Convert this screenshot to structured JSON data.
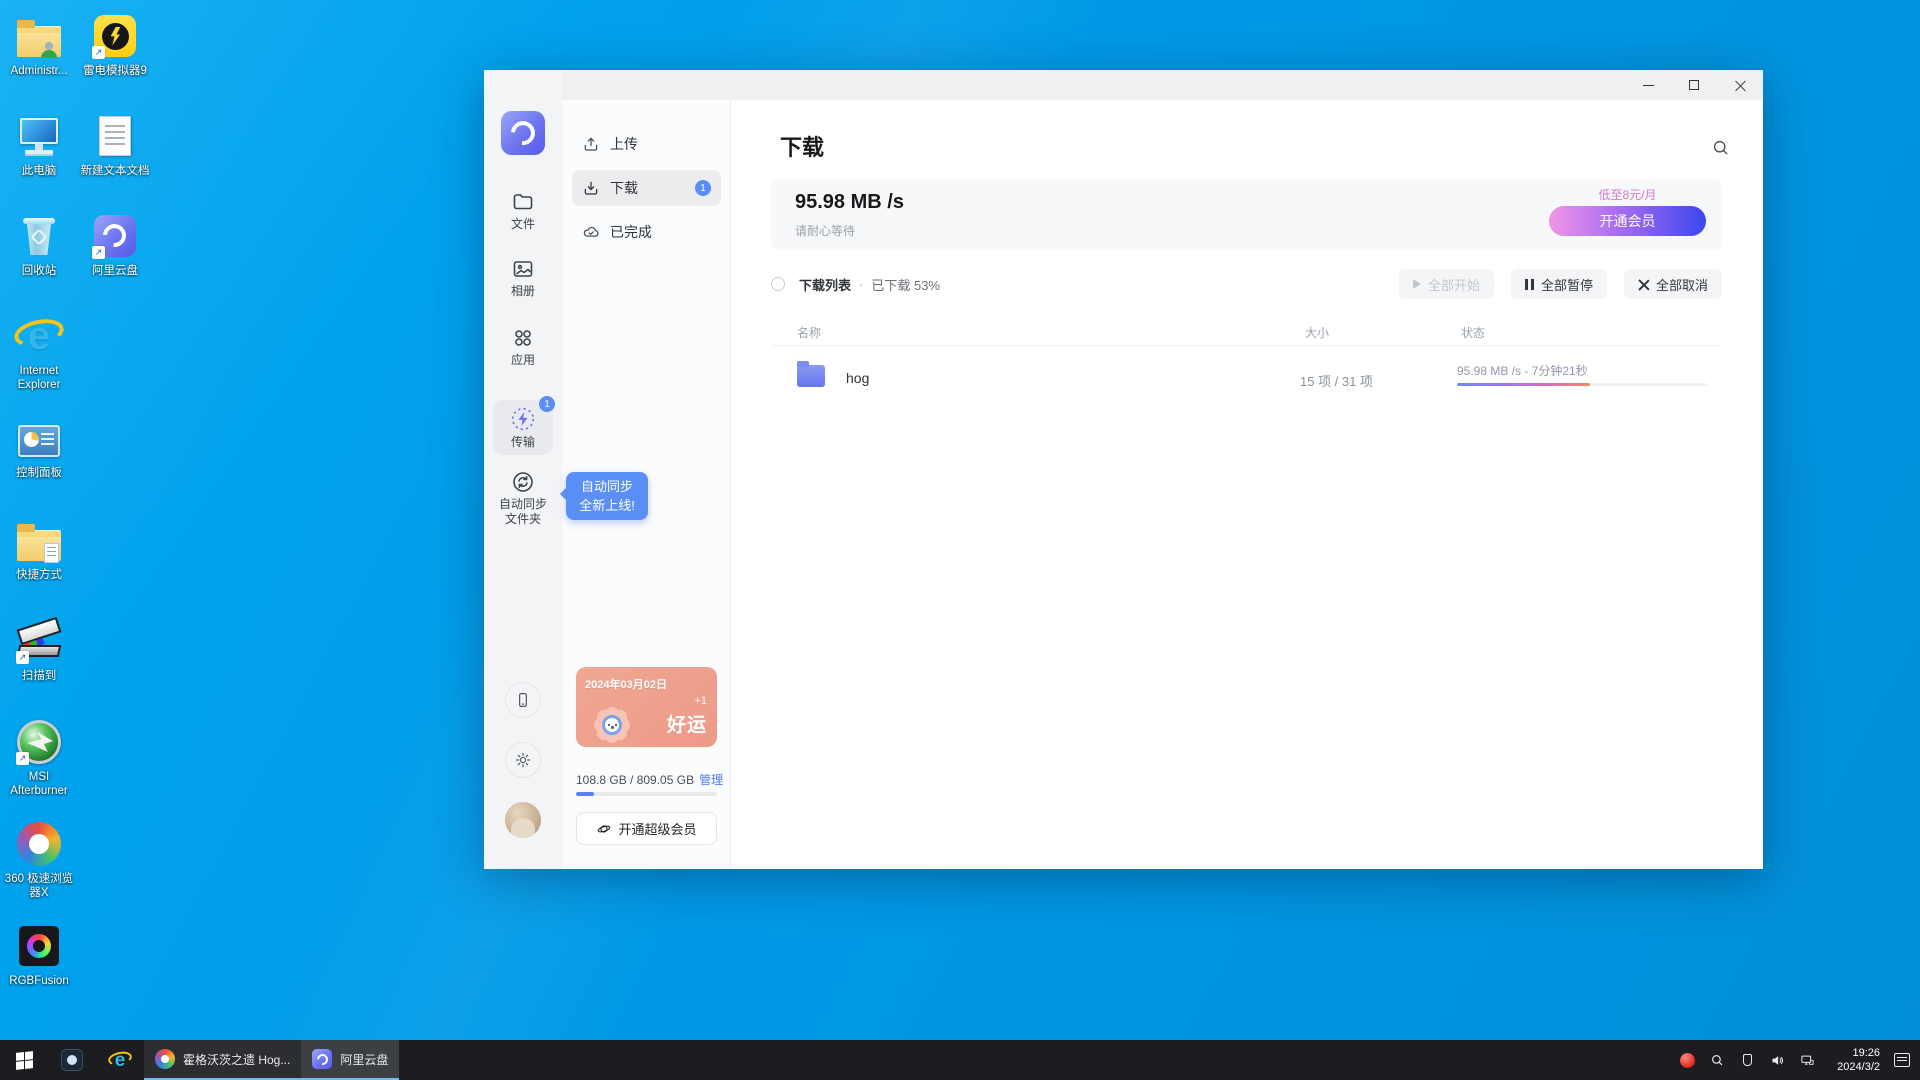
{
  "desktop": {
    "icons": [
      {
        "label": "Administr...",
        "icon": "user-folder-icon"
      },
      {
        "label": "雷电模拟器9",
        "icon": "ldplayer-icon"
      },
      {
        "label": "此电脑",
        "icon": "this-pc-icon"
      },
      {
        "label": "新建文本文档",
        "icon": "text-document-icon"
      },
      {
        "label": "回收站",
        "icon": "recycle-bin-icon"
      },
      {
        "label": "阿里云盘",
        "icon": "aliyun-drive-icon"
      },
      {
        "label": "Internet Explorer",
        "icon": "internet-explorer-icon"
      },
      {
        "label": "控制面板",
        "icon": "control-panel-icon"
      },
      {
        "label": "快捷方式",
        "icon": "shortcut-folder-icon"
      },
      {
        "label": "扫描到",
        "icon": "scanner-icon"
      },
      {
        "label": "MSI Afterburner",
        "icon": "msi-afterburner-icon"
      },
      {
        "label": "360 极速浏览器X",
        "icon": "browser-360-icon"
      },
      {
        "label": "RGBFusion",
        "icon": "rgbfusion-icon"
      }
    ]
  },
  "window": {
    "rail": {
      "files": "文件",
      "albums": "相册",
      "apps": "应用",
      "transfer": "传输",
      "transfer_badge": "1",
      "sync_line1": "自动同步",
      "sync_line2": "文件夹"
    },
    "nav": {
      "upload": "上传",
      "download": "下载",
      "download_badge": "1",
      "completed": "已完成"
    },
    "tooltip": {
      "line1": "自动同步",
      "line2": "全新上线!"
    },
    "date_card": {
      "date": "2024年03月02日",
      "plus": "+1",
      "word": "好运"
    },
    "storage": {
      "used_total": "108.8 GB / 809.05 GB",
      "manage_link": "管理",
      "percent_used": 13
    },
    "super_vip_button": "开通超级会员",
    "main": {
      "title": "下载",
      "banner": {
        "speed": "95.98 MB /s",
        "hint": "请耐心等待",
        "promo": "低至8元/月",
        "vip_button": "开通会员"
      },
      "controls": {
        "list_label": "下载列表",
        "separator": "·",
        "progress_label": "已下载 53%",
        "start_all": "全部开始",
        "pause_all": "全部暂停",
        "cancel_all": "全部取消"
      },
      "table": {
        "columns": {
          "name": "名称",
          "size": "大小",
          "status": "状态"
        },
        "rows": [
          {
            "name": "hog",
            "size": "15 项 / 31 项",
            "status": "95.98 MB /s - 7分钟21秒",
            "percent": 53
          }
        ]
      }
    }
  },
  "taskbar": {
    "apps": [
      {
        "label": "霍格沃茨之遗 Hog..."
      },
      {
        "label": "阿里云盘"
      }
    ],
    "clock": {
      "time": "19:26",
      "date": "2024/3/2"
    }
  },
  "colors": {
    "accent_blue": "#5b8cf8",
    "vip_gradient_start": "#f095e6",
    "vip_gradient_end": "#3d46ee",
    "date_card_salmon": "#efa28f",
    "desktop_blue": "#009ce6"
  }
}
